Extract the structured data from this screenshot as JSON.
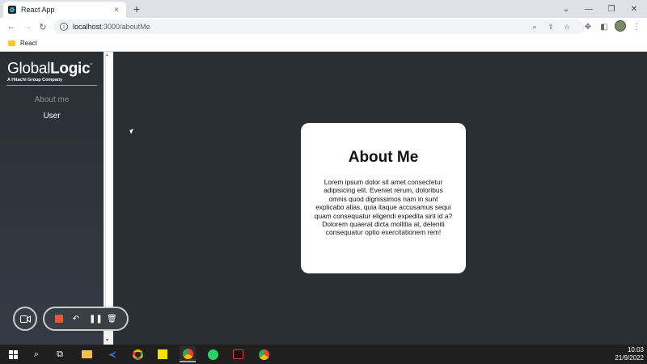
{
  "browser": {
    "tab_title": "React App",
    "tab_close": "×",
    "new_tab": "+",
    "url_host": "localhost",
    "url_path": ":3000/aboutMe",
    "bookmark": "React"
  },
  "sidebar": {
    "logo_regular": "Global",
    "logo_bold": "Logic",
    "logo_mark": "°",
    "logo_tagline": "A Hitachi Group Company",
    "items": [
      {
        "label": "About me"
      },
      {
        "label": "User"
      }
    ]
  },
  "card": {
    "title": "About Me",
    "body": "Lorem ipsum dolor sit amet consectetur adipisicing elit. Eveniet rerum, doloribus omnis quod dignissimos nam in sunt explicabo alias, quia itaque accusamus sequi quam consequatur eligendi expedita sint id a? Dolorem quaerat dicta mollitia at, deleniti consequatur optio exercitationem rem!"
  },
  "taskbar": {
    "time": "10:03",
    "date": "21/9/2022"
  },
  "colors": {
    "page_background": "#2a2e35",
    "card_background": "#ffffff",
    "record_stop": "#f0533c",
    "taskbar": "#1f1f20"
  }
}
